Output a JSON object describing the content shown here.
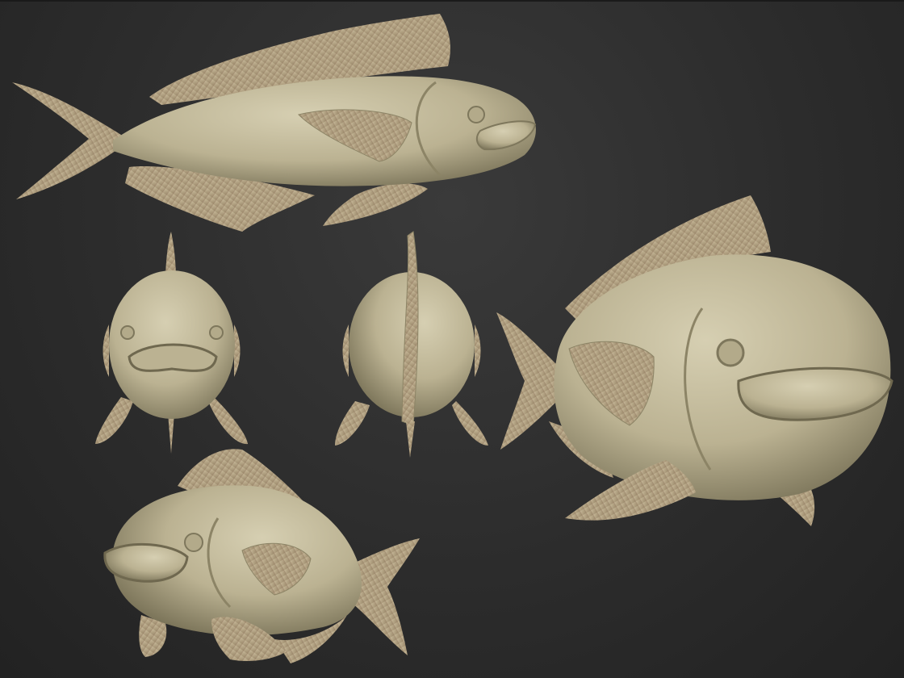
{
  "scene": {
    "background_color": "#2e2e2e",
    "clay_color": "#c2b998",
    "clay_shadow": "#8c8466",
    "fin_color": "#b3a282",
    "fin_groove": "#8a7058",
    "views": [
      {
        "name": "side-view-left"
      },
      {
        "name": "front-view"
      },
      {
        "name": "back-view"
      },
      {
        "name": "three-quarter-view-large"
      },
      {
        "name": "three-quarter-view-small"
      }
    ]
  }
}
